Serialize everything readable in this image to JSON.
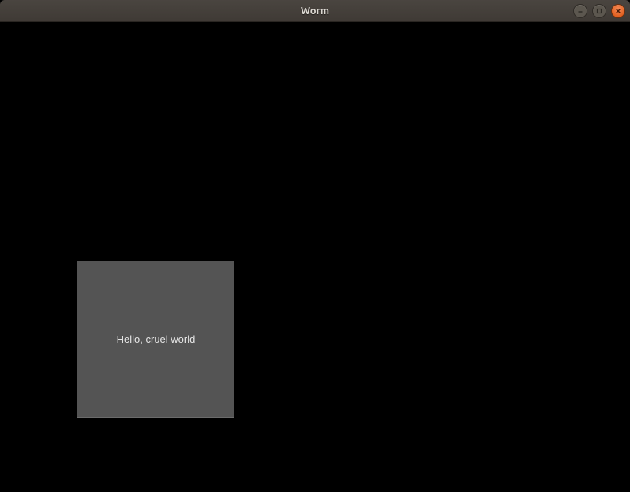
{
  "titlebar": {
    "title": "Worm"
  },
  "content": {
    "box_text": "Hello, cruel world"
  },
  "icons": {
    "minimize": "minimize-icon",
    "maximize": "maximize-icon",
    "close": "close-icon"
  }
}
